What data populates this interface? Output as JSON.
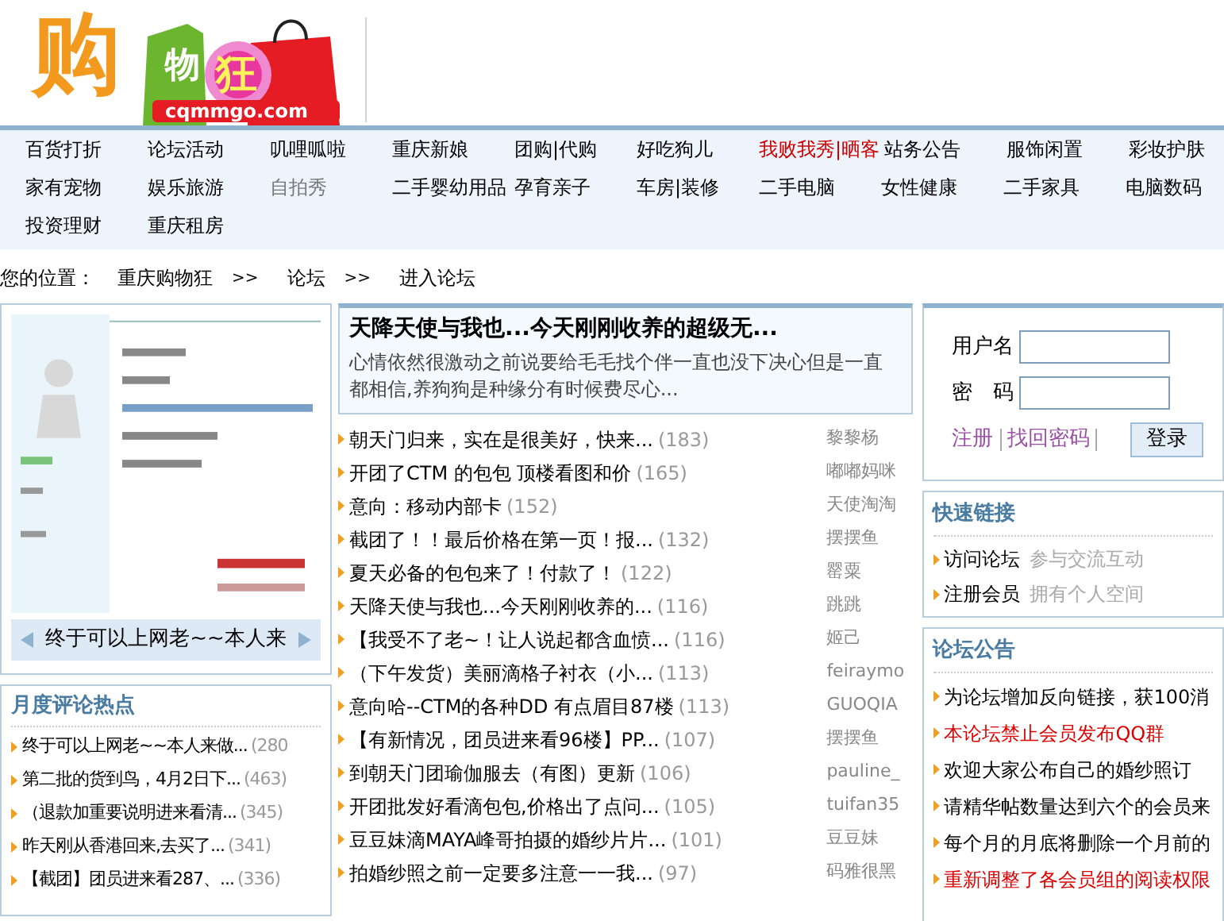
{
  "logo": {
    "big": "购",
    "mid": "物",
    "flower": "狂",
    "domain": "cqmmgo.com"
  },
  "nav": [
    [
      {
        "label": "百货打折",
        "color": "#000000"
      },
      {
        "label": "论坛活动",
        "color": "#000000"
      },
      {
        "label": "叽哩呱啦",
        "color": "#000000"
      },
      {
        "label": "重庆新娘",
        "color": "#000000"
      },
      {
        "label": "团购|代购",
        "color": "#000000"
      },
      {
        "label": "好吃狗儿",
        "color": "#000000"
      },
      {
        "label": "我败我秀|晒客",
        "color": "#cc0000"
      },
      {
        "label": "站务公告",
        "color": "#000000"
      },
      {
        "label": "服饰闲置",
        "color": "#000000"
      },
      {
        "label": "彩妆护肤",
        "color": "#000000"
      }
    ],
    [
      {
        "label": "家有宠物",
        "color": "#000000"
      },
      {
        "label": "娱乐旅游",
        "color": "#000000"
      },
      {
        "label": "自拍秀",
        "color": "#777777"
      },
      {
        "label": "二手婴幼用品",
        "color": "#000000"
      },
      {
        "label": "孕育亲子",
        "color": "#000000"
      },
      {
        "label": "车房|装修",
        "color": "#000000"
      },
      {
        "label": "二手电脑",
        "color": "#000000"
      },
      {
        "label": "女性健康",
        "color": "#000000"
      },
      {
        "label": "二手家具",
        "color": "#000000"
      },
      {
        "label": "电脑数码",
        "color": "#000000"
      }
    ],
    [
      {
        "label": "投资理财",
        "color": "#000000"
      },
      {
        "label": "重庆租房",
        "color": "#000000"
      }
    ]
  ],
  "breadcrumb": {
    "label": "您的位置：",
    "items": [
      "重庆购物狂",
      "论坛",
      "进入论坛"
    ],
    "separator": ">>"
  },
  "slideshow": {
    "caption": "终于可以上网老~~本人来"
  },
  "hot_comments": {
    "title": "月度评论热点",
    "items": [
      {
        "title": "终于可以上网老~~本人来做...",
        "count": "(280"
      },
      {
        "title": "第二批的货到鸟，4月2日下...",
        "count": "(463)"
      },
      {
        "title": "（退款加重要说明进来看清...",
        "count": "(345)"
      },
      {
        "title": "昨天刚从香港回来,去买了...",
        "count": "(341)"
      },
      {
        "title": "【截团】团员进来看287、...",
        "count": "(336)"
      }
    ]
  },
  "featured": {
    "title": "天降天使与我也...今天刚刚收养的超级无...",
    "summary": "心情依然很激动之前说要给毛毛找个伴一直也没下决心但是一直都相信,养狗狗是种缘分有时候费尽心..."
  },
  "threads": [
    {
      "title": "朝天门归来，实在是很美好，快来...",
      "count": "(183)",
      "author": "黎黎杨"
    },
    {
      "title": "开团了CTM 的包包  顶楼看图和价",
      "count": "(165)",
      "author": "嘟嘟妈咪"
    },
    {
      "title": "意向：移动内部卡",
      "count": "(152)",
      "author": "天使淘淘"
    },
    {
      "title": "截团了！！最后价格在第一页！报...",
      "count": "(132)",
      "author": "摆摆鱼"
    },
    {
      "title": "夏天必备的包包来了！付款了！",
      "count": "(122)",
      "author": "罂粟"
    },
    {
      "title": "天降天使与我也...今天刚刚收养的...",
      "count": "(116)",
      "author": "跳跳"
    },
    {
      "title": "【我受不了老~！让人说起都含血愤...",
      "count": "(116)",
      "author": "姬己"
    },
    {
      "title": "（下午发货）美丽滴格子衬衣（小...",
      "count": "(113)",
      "author": "feiraymo"
    },
    {
      "title": "意向哈--CTM的各种DD 有点眉目87楼",
      "count": "(113)",
      "author": "GUOQIA"
    },
    {
      "title": "【有新情况，团员进来看96楼】PP...",
      "count": "(107)",
      "author": "摆摆鱼"
    },
    {
      "title": "到朝天门团瑜伽服去（有图）更新",
      "count": "(106)",
      "author": "pauline_"
    },
    {
      "title": "开团批发好看滴包包,价格出了点问...",
      "count": "(105)",
      "author": "tuifan35"
    },
    {
      "title": "豆豆妹滴MAYA峰哥拍摄的婚纱片片...",
      "count": "(101)",
      "author": "豆豆妹"
    },
    {
      "title": "拍婚纱照之前一定要多注意一一我...",
      "count": "(97)",
      "author": "码雅很黑"
    }
  ],
  "login": {
    "username_label": "用户名",
    "password_label": "密　码",
    "register": "注册",
    "forgot": "找回密码",
    "submit": "登录"
  },
  "quick_links": {
    "title": "快速链接",
    "items": [
      {
        "label": "访问论坛",
        "note": "参与交流互动"
      },
      {
        "label": "注册会员",
        "note": "拥有个人空间"
      }
    ]
  },
  "notices": {
    "title": "论坛公告",
    "items": [
      {
        "text": "为论坛增加反向链接，获100消",
        "color": "#000000"
      },
      {
        "text": "本论坛禁止会员发布QQ群",
        "color": "#dd0000"
      },
      {
        "text": "欢迎大家公布自己的婚纱照订",
        "color": "#000000"
      },
      {
        "text": "请精华帖数量达到六个的会员来",
        "color": "#000000"
      },
      {
        "text": "每个月的月底将删除一个月前的",
        "color": "#000000"
      },
      {
        "text": "重新调整了各会员组的阅读权限",
        "color": "#dd0000"
      }
    ]
  }
}
